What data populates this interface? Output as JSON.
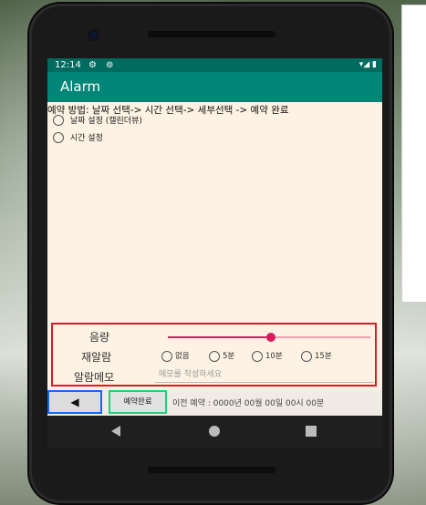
{
  "status": {
    "time": "12:14",
    "gear_icon": "⚙",
    "record_icon": "⊚",
    "right_icons": "▾◢ ▮"
  },
  "app": {
    "title": "Alarm"
  },
  "instructions": "예약 방법: 날짜 선택-> 시간 선택-> 세부선택 -> 예약 완료",
  "options": {
    "date_label": "날짜 설정 (캘린더뷰)",
    "time_label": "시간 설정"
  },
  "volume": {
    "label": "음량",
    "level": 0.51
  },
  "snooze": {
    "label": "재알람",
    "options": [
      "없음",
      "5분",
      "10분",
      "15분"
    ]
  },
  "memo": {
    "label": "알람메모",
    "placeholder": "메모를 작성하세요"
  },
  "bottom": {
    "back_label": "◀",
    "done_label": "예약완료",
    "previous": "이전 예약 : 0000년 00월 00일 00시 00분"
  },
  "colors": {
    "status_bar": "#006b5e",
    "app_bar": "#008577",
    "accent": "#d81b60",
    "red_outline": "#d81b2a",
    "blue_outline": "#1565ff",
    "green_outline": "#20d07a",
    "screen_bg": "#fdf2e3"
  }
}
